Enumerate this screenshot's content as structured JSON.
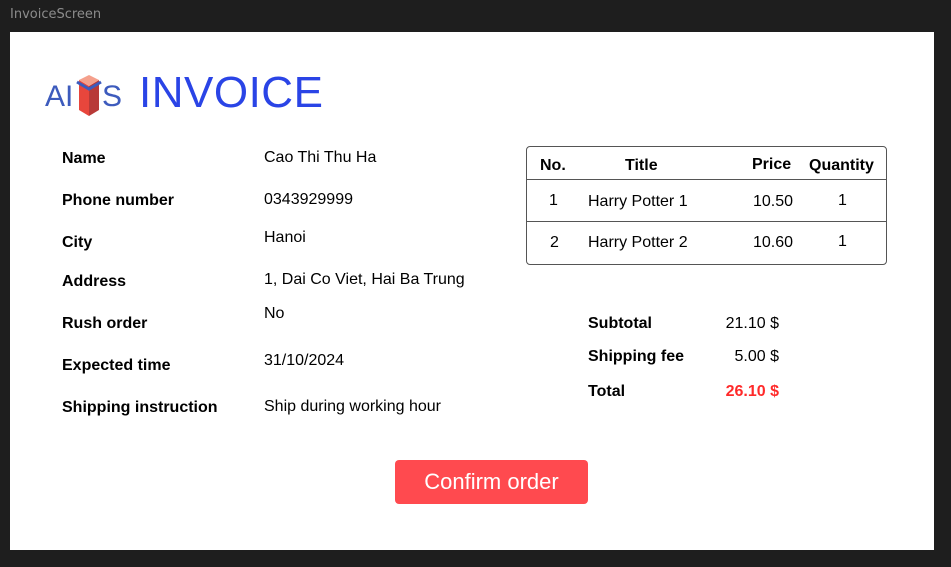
{
  "window": {
    "title": "InvoiceScreen"
  },
  "header": {
    "logo_text": "AIMS",
    "title": "INVOICE"
  },
  "customer": {
    "fields": [
      {
        "label": "Name",
        "value": "Cao Thi Thu Ha"
      },
      {
        "label": "Phone number",
        "value": "0343929999"
      },
      {
        "label": "City",
        "value": "Hanoi"
      },
      {
        "label": "Address",
        "value": "1, Dai Co Viet, Hai Ba Trung"
      },
      {
        "label": "Rush order",
        "value": "No"
      },
      {
        "label": "Expected time",
        "value": "31/10/2024"
      },
      {
        "label": "Shipping instruction",
        "value": "Ship during working hour"
      }
    ]
  },
  "items": {
    "headers": {
      "no": "No.",
      "title": "Title",
      "price": "Price",
      "quantity": "Quantity"
    },
    "rows": [
      {
        "no": "1",
        "title": "Harry Potter 1",
        "price": "10.50",
        "quantity": "1"
      },
      {
        "no": "2",
        "title": "Harry Potter 2",
        "price": "10.60",
        "quantity": "1"
      }
    ]
  },
  "summary": {
    "subtotal_label": "Subtotal",
    "subtotal": "21.10 $",
    "shipping_label": "Shipping fee",
    "shipping": "5.00 $",
    "total_label": "Total",
    "total": "26.10 $"
  },
  "actions": {
    "confirm_label": "Confirm order"
  },
  "colors": {
    "brand_blue": "#2a44e6",
    "logo_red": "#e8463c",
    "accent": "#ff4a4f",
    "total": "#ff2a2a"
  }
}
